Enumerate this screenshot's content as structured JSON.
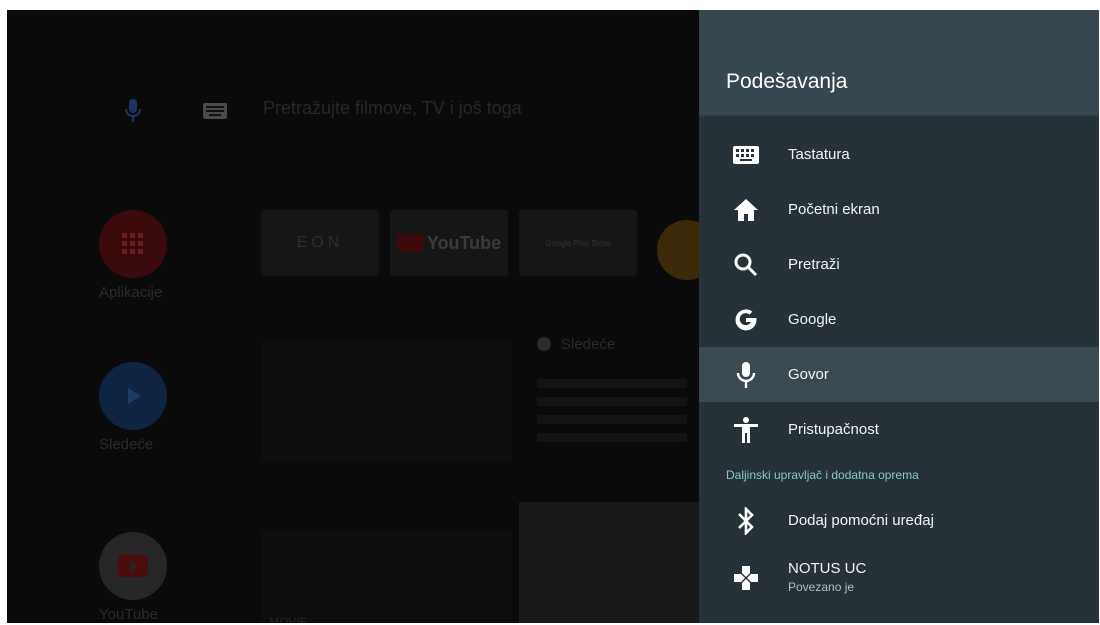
{
  "launcher": {
    "search_placeholder": "Pretražujte filmove, TV i još toga",
    "side_apps": [
      {
        "label": "Aplikacije",
        "icon": "apps-grid-icon"
      },
      {
        "label": "Sledeće",
        "icon": "play-icon"
      },
      {
        "label": "YouTube",
        "icon": "youtube-icon"
      }
    ],
    "tiles": [
      {
        "label": "EON"
      },
      {
        "label": "YouTube"
      },
      {
        "label": "Google Play Store"
      }
    ],
    "next_label": "Sledeće",
    "row_label": "MOVIE"
  },
  "panel": {
    "title": "Podešavanja",
    "items": [
      {
        "label": "Tastatura",
        "icon": "keyboard-icon"
      },
      {
        "label": "Početni ekran",
        "icon": "home-icon"
      },
      {
        "label": "Pretraži",
        "icon": "search-icon"
      },
      {
        "label": "Google",
        "icon": "google-icon"
      },
      {
        "label": "Govor",
        "icon": "microphone-icon"
      },
      {
        "label": "Pristupačnost",
        "icon": "accessibility-icon"
      }
    ],
    "section_header": "Daljinski upravljač i dodatna oprema",
    "accessory_items": [
      {
        "label": "Dodaj pomoćni uređaj",
        "icon": "bluetooth-icon"
      },
      {
        "label": "NOTUS UC",
        "sublabel": "Povezano je",
        "icon": "gamepad-icon"
      }
    ]
  },
  "colors": {
    "panel_bg": "#263238",
    "panel_header_bg": "#37474f",
    "focused_row_bg": "#3b4a51",
    "section_header": "#80cbc4"
  }
}
